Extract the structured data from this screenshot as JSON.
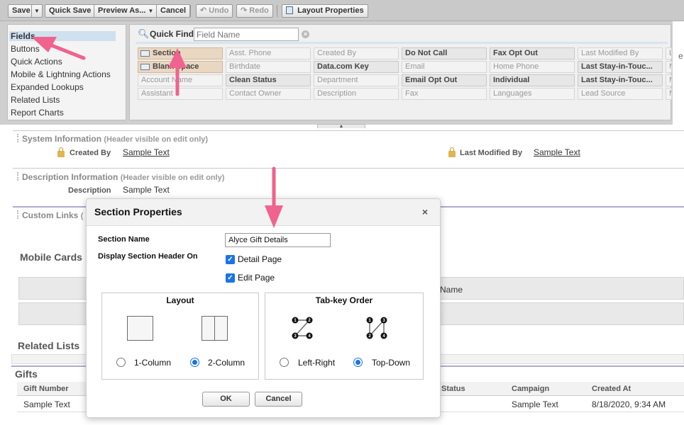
{
  "toolbar": {
    "save": "Save",
    "save_menu": "▼",
    "quick_save": "Quick Save",
    "preview_as": "Preview As...",
    "preview_menu": "▼",
    "cancel": "Cancel",
    "undo": "Undo",
    "redo": "Redo",
    "layout_properties": "Layout Properties"
  },
  "palette": {
    "categories": [
      "Fields",
      "Buttons",
      "Quick Actions",
      "Mobile & Lightning Actions",
      "Expanded Lookups",
      "Related Lists",
      "Report Charts"
    ],
    "quick_find_label": "Quick Find",
    "quick_find_placeholder": "Field Name",
    "clear": "×",
    "fields": [
      [
        "Section",
        "Asst. Phone",
        "Created By",
        "Do Not Call",
        "Fax Opt Out",
        "Last Modified By",
        "L"
      ],
      [
        "Blank Space",
        "Birthdate",
        "Data.com Key",
        "Email",
        "Home Phone",
        "Last Stay-in-Touc...",
        "M"
      ],
      [
        "Account Name",
        "Clean Status",
        "Department",
        "Email Opt Out",
        "Individual",
        "Last Stay-in-Touc...",
        "M"
      ],
      [
        "Assistant",
        "Contact Owner",
        "Description",
        "Fax",
        "Languages",
        "Lead Source",
        "M"
      ]
    ],
    "handle": "▲"
  },
  "canvas": {
    "system_info": {
      "title": "System Information",
      "sub": "(Header visible on edit only)"
    },
    "created_by_label": "Created By",
    "created_by_value": "Sample Text",
    "last_modified_label": "Last Modified By",
    "last_modified_value": "Sample Text",
    "description_info": {
      "title": "Description Information",
      "sub": "(Header visible on edit only)"
    },
    "description_label": "Description",
    "description_value": "Sample Text",
    "custom_links": "Custom Links",
    "custom_links_partial": "(",
    "mobile_cards": "Mobile Cards",
    "name_col_partial": "Name",
    "related_lists": "Related Lists",
    "gifts": "Gifts",
    "gift_columns": [
      "Gift Number",
      "Status",
      "Campaign",
      "Created At"
    ],
    "gift_row": [
      "Sample Text",
      "",
      "Sample Text",
      "8/18/2020, 9:34 AM"
    ],
    "right_edge_partial": "e"
  },
  "dialog": {
    "title": "Section Properties",
    "close": "×",
    "section_name_label": "Section Name",
    "section_name_value": "Alyce Gift Details",
    "display_header_label": "Display Section Header On",
    "detail_page": "Detail Page",
    "edit_page": "Edit Page",
    "check": "✓",
    "layout_title": "Layout",
    "one_column": "1-Column",
    "two_column": "2-Column",
    "tab_order_title": "Tab-key Order",
    "left_right": "Left-Right",
    "top_down": "Top-Down",
    "ok": "OK",
    "cancel": "Cancel",
    "selected_layout": "2-Column",
    "selected_tab_order": "Top-Down"
  },
  "colors": {
    "annotation_arrow": "#f0638e",
    "checkbox_blue": "#1a73e8",
    "section_chip": "#ead7c2",
    "active_category": "#cfe0ef"
  },
  "icons": [
    "undo-icon",
    "redo-icon",
    "layout-properties-icon",
    "search-icon",
    "clear-icon",
    "section-icon",
    "blank-space-icon",
    "lock-icon",
    "close-icon",
    "one-column-icon",
    "two-column-icon",
    "left-right-order-icon",
    "top-down-order-icon",
    "annotation-arrow"
  ]
}
